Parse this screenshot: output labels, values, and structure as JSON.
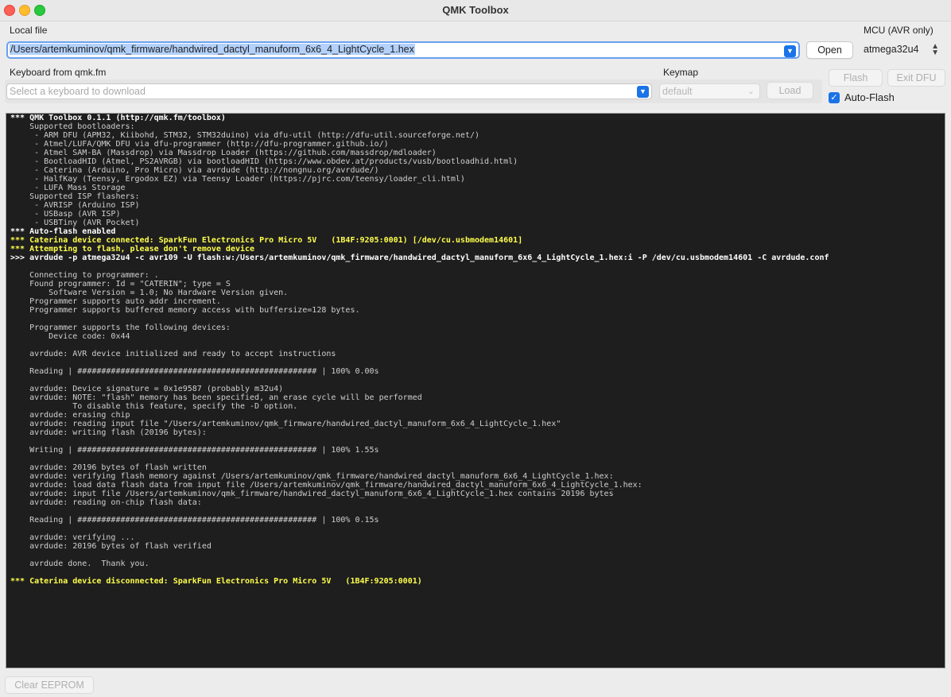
{
  "window": {
    "title": "QMK Toolbox"
  },
  "local_file": {
    "label": "Local file",
    "value": "/Users/artemkuminov/qmk_firmware/handwired_dactyl_manuform_6x6_4_LightCycle_1.hex",
    "open_label": "Open"
  },
  "mcu": {
    "label": "MCU (AVR only)",
    "value": "atmega32u4"
  },
  "keyboard": {
    "label": "Keyboard from qmk.fm",
    "placeholder": "Select a keyboard to download",
    "keymap_label": "Keymap",
    "keymap_value": "default",
    "load_label": "Load"
  },
  "actions": {
    "flash_label": "Flash",
    "exit_dfu_label": "Exit DFU",
    "auto_flash_label": "Auto-Flash",
    "auto_flash_checked": true,
    "clear_eeprom_label": "Clear EEPROM"
  },
  "console": {
    "lines": [
      {
        "type": "info",
        "text": "*** QMK Toolbox 0.1.1 (http://qmk.fm/toolbox)"
      },
      {
        "type": "bl",
        "text": "    Supported bootloaders:"
      },
      {
        "type": "bl",
        "text": "     - ARM DFU (APM32, Kiibohd, STM32, STM32duino) via dfu-util (http://dfu-util.sourceforge.net/)"
      },
      {
        "type": "bl",
        "text": "     - Atmel/LUFA/QMK DFU via dfu-programmer (http://dfu-programmer.github.io/)"
      },
      {
        "type": "bl",
        "text": "     - Atmel SAM-BA (Massdrop) via Massdrop Loader (https://github.com/massdrop/mdloader)"
      },
      {
        "type": "bl",
        "text": "     - BootloadHID (Atmel, PS2AVRGB) via bootloadHID (https://www.obdev.at/products/vusb/bootloadhid.html)"
      },
      {
        "type": "bl",
        "text": "     - Caterina (Arduino, Pro Micro) via avrdude (http://nongnu.org/avrdude/)"
      },
      {
        "type": "bl",
        "text": "     - HalfKay (Teensy, Ergodox EZ) via Teensy Loader (https://pjrc.com/teensy/loader_cli.html)"
      },
      {
        "type": "bl",
        "text": "     - LUFA Mass Storage"
      },
      {
        "type": "bl",
        "text": "    Supported ISP flashers:"
      },
      {
        "type": "bl",
        "text": "     - AVRISP (Arduino ISP)"
      },
      {
        "type": "bl",
        "text": "     - USBasp (AVR ISP)"
      },
      {
        "type": "bl",
        "text": "     - USBTiny (AVR Pocket)"
      },
      {
        "type": "info",
        "text": "*** Auto-flash enabled"
      },
      {
        "type": "hw",
        "text": "*** Caterina device connected: SparkFun Electronics Pro Micro 5V   (1B4F:9205:0001) [/dev/cu.usbmodem14601]"
      },
      {
        "type": "hw",
        "text": "*** Attempting to flash, please don't remove device"
      },
      {
        "type": "cmd",
        "text": ">>> avrdude -p atmega32u4 -c avr109 -U flash:w:/Users/artemkuminov/qmk_firmware/handwired_dactyl_manuform_6x6_4_LightCycle_1.hex:i -P /dev/cu.usbmodem14601 -C avrdude.conf"
      },
      {
        "type": "out",
        "text": ""
      },
      {
        "type": "out",
        "text": "    Connecting to programmer: ."
      },
      {
        "type": "out",
        "text": "    Found programmer: Id = \"CATERIN\"; type = S"
      },
      {
        "type": "out",
        "text": "        Software Version = 1.0; No Hardware Version given."
      },
      {
        "type": "out",
        "text": "    Programmer supports auto addr increment."
      },
      {
        "type": "out",
        "text": "    Programmer supports buffered memory access with buffersize=128 bytes."
      },
      {
        "type": "out",
        "text": ""
      },
      {
        "type": "out",
        "text": "    Programmer supports the following devices:"
      },
      {
        "type": "out",
        "text": "        Device code: 0x44"
      },
      {
        "type": "out",
        "text": ""
      },
      {
        "type": "out",
        "text": "    avrdude: AVR device initialized and ready to accept instructions"
      },
      {
        "type": "out",
        "text": ""
      },
      {
        "type": "out",
        "text": "    Reading | ################################################## | 100% 0.00s"
      },
      {
        "type": "out",
        "text": ""
      },
      {
        "type": "out",
        "text": "    avrdude: Device signature = 0x1e9587 (probably m32u4)"
      },
      {
        "type": "out",
        "text": "    avrdude: NOTE: \"flash\" memory has been specified, an erase cycle will be performed"
      },
      {
        "type": "out",
        "text": "             To disable this feature, specify the -D option."
      },
      {
        "type": "out",
        "text": "    avrdude: erasing chip"
      },
      {
        "type": "out",
        "text": "    avrdude: reading input file \"/Users/artemkuminov/qmk_firmware/handwired_dactyl_manuform_6x6_4_LightCycle_1.hex\""
      },
      {
        "type": "out",
        "text": "    avrdude: writing flash (20196 bytes):"
      },
      {
        "type": "out",
        "text": ""
      },
      {
        "type": "out",
        "text": "    Writing | ################################################## | 100% 1.55s"
      },
      {
        "type": "out",
        "text": ""
      },
      {
        "type": "out",
        "text": "    avrdude: 20196 bytes of flash written"
      },
      {
        "type": "out",
        "text": "    avrdude: verifying flash memory against /Users/artemkuminov/qmk_firmware/handwired_dactyl_manuform_6x6_4_LightCycle_1.hex:"
      },
      {
        "type": "out",
        "text": "    avrdude: load data flash data from input file /Users/artemkuminov/qmk_firmware/handwired_dactyl_manuform_6x6_4_LightCycle_1.hex:"
      },
      {
        "type": "out",
        "text": "    avrdude: input file /Users/artemkuminov/qmk_firmware/handwired_dactyl_manuform_6x6_4_LightCycle_1.hex contains 20196 bytes"
      },
      {
        "type": "out",
        "text": "    avrdude: reading on-chip flash data:"
      },
      {
        "type": "out",
        "text": ""
      },
      {
        "type": "out",
        "text": "    Reading | ################################################## | 100% 0.15s"
      },
      {
        "type": "out",
        "text": ""
      },
      {
        "type": "out",
        "text": "    avrdude: verifying ..."
      },
      {
        "type": "out",
        "text": "    avrdude: 20196 bytes of flash verified"
      },
      {
        "type": "out",
        "text": ""
      },
      {
        "type": "out",
        "text": "    avrdude done.  Thank you."
      },
      {
        "type": "out",
        "text": ""
      },
      {
        "type": "hw",
        "text": "*** Caterina device disconnected: SparkFun Electronics Pro Micro 5V   (1B4F:9205:0001)"
      }
    ]
  }
}
